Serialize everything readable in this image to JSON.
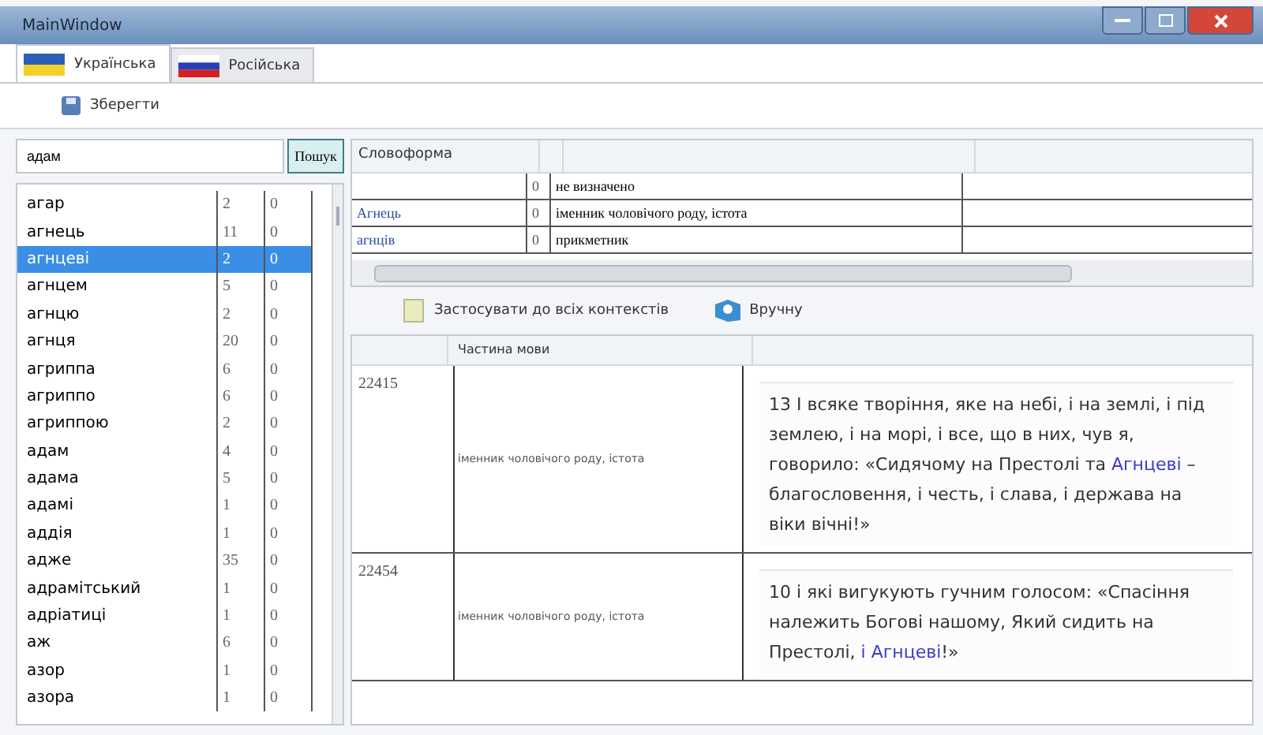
{
  "window": {
    "title": "MainWindow"
  },
  "tabs": [
    {
      "label": "Українська",
      "kind": "ua",
      "selected": true
    },
    {
      "label": "Російська",
      "kind": "ru",
      "selected": false
    }
  ],
  "toolbar": {
    "save": "Зберегти"
  },
  "search": {
    "value": "адам",
    "button": "Пошук"
  },
  "words": [
    {
      "word": "агар",
      "count": "2",
      "flag": "0",
      "selected": false
    },
    {
      "word": "агнець",
      "count": "11",
      "flag": "0",
      "selected": false
    },
    {
      "word": "агнцеві",
      "count": "2",
      "flag": "0",
      "selected": true
    },
    {
      "word": "агнцем",
      "count": "5",
      "flag": "0",
      "selected": false
    },
    {
      "word": "агнцю",
      "count": "2",
      "flag": "0",
      "selected": false
    },
    {
      "word": "агнця",
      "count": "20",
      "flag": "0",
      "selected": false
    },
    {
      "word": "агриппа",
      "count": "6",
      "flag": "0",
      "selected": false
    },
    {
      "word": "агриппо",
      "count": "6",
      "flag": "0",
      "selected": false
    },
    {
      "word": "агриппою",
      "count": "2",
      "flag": "0",
      "selected": false
    },
    {
      "word": "адам",
      "count": "4",
      "flag": "0",
      "selected": false
    },
    {
      "word": "адама",
      "count": "5",
      "flag": "0",
      "selected": false
    },
    {
      "word": "адамі",
      "count": "1",
      "flag": "0",
      "selected": false
    },
    {
      "word": "аддія",
      "count": "1",
      "flag": "0",
      "selected": false
    },
    {
      "word": "адже",
      "count": "35",
      "flag": "0",
      "selected": false
    },
    {
      "word": "адрамітський",
      "count": "1",
      "flag": "0",
      "selected": false
    },
    {
      "word": "адріатиці",
      "count": "1",
      "flag": "0",
      "selected": false
    },
    {
      "word": "аж",
      "count": "6",
      "flag": "0",
      "selected": false
    },
    {
      "word": "азор",
      "count": "1",
      "flag": "0",
      "selected": false
    },
    {
      "word": "азора",
      "count": "1",
      "flag": "0",
      "selected": false
    }
  ],
  "forms": {
    "columns": [
      "Словоформа"
    ],
    "rows": [
      {
        "form": "",
        "num": "0",
        "pos": "не визначено"
      },
      {
        "form": "Агнець",
        "num": "0",
        "pos": "іменник чоловічого роду, істота"
      },
      {
        "form": "агнців",
        "num": "0",
        "pos": "прикметник"
      }
    ]
  },
  "actions": {
    "apply_all": "Застосувати до всіх контекстів",
    "manual": "Вручну"
  },
  "contexts": {
    "columns": [
      "Частина мови"
    ],
    "rows": [
      {
        "id": "22415",
        "pos": "іменник чоловічого роду, істота",
        "segments": [
          {
            "text": "13 І всяке творіння, яке на небі, і на землі, і під землею, і на морі, і все, що в них, чув я, говорило: «Сидячому на Престолі та ",
            "highlighted": false
          },
          {
            "text": "Агнцеві",
            "highlighted": true
          },
          {
            "text": " – благословення, і честь, і слава, і держава на віки вічні!»",
            "highlighted": false
          }
        ]
      },
      {
        "id": "22454",
        "pos": "іменник чоловічого роду, істота",
        "segments": [
          {
            "text": "10 і які вигукують гучним голосом: «Спасіння належить Богові нашому, Який сидить на Престолі, ",
            "highlighted": false
          },
          {
            "text": "і Агнцеві",
            "highlighted": true
          },
          {
            "text": "!»",
            "highlighted": false
          }
        ]
      }
    ]
  }
}
